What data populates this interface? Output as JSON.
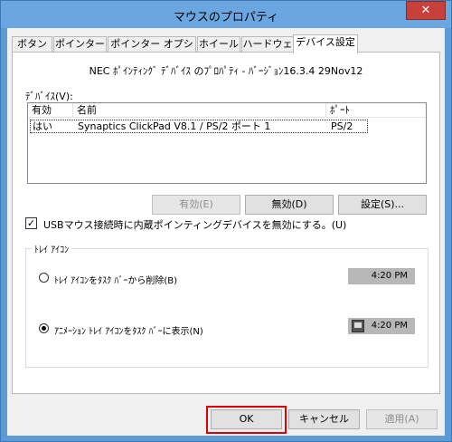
{
  "window": {
    "title": "マウスのプロパティ",
    "close_label": "✕"
  },
  "tabs": [
    {
      "label": "ボタン",
      "active": false
    },
    {
      "label": "ポインター",
      "active": false
    },
    {
      "label": "ポインター オプション",
      "active": false
    },
    {
      "label": "ホイール",
      "active": false
    },
    {
      "label": "ハードウェア",
      "active": false
    },
    {
      "label": "デバイス設定",
      "active": true
    }
  ],
  "device_settings": {
    "properties_line": "NEC ﾎﾟｲﾝﾃｨﾝｸﾞ ﾃﾞﾊﾞｲｽ のﾌﾟﾛﾊﾟﾃｨ - ﾊﾞｰｼﾞｮﾝ16.3.4 29Nov12",
    "devices_label": "ﾃﾞﾊﾞｲｽ(V):",
    "list": {
      "columns": [
        "有効",
        "名前",
        "ﾎﾟｰﾄ"
      ],
      "rows": [
        {
          "enabled": "はい",
          "name": "Synaptics ClickPad V8.1 / PS/2 ポート 1",
          "port": "PS/2"
        }
      ]
    },
    "buttons": {
      "enable": "有効(E)",
      "disable": "無効(D)",
      "settings": "設定(S)..."
    },
    "checkbox": {
      "label": "USBマウス接続時に内蔵ポインティングデバイスを無効にする。(U)",
      "checked": true,
      "mark": "✓"
    },
    "tray_group": {
      "title": "ﾄﾚｲ ｱｲｺﾝ",
      "option_remove": {
        "label": "ﾄﾚｲ ｱｲｺﾝをﾀｽｸ ﾊﾞｰから削除(B)",
        "checked": false,
        "time": "4:20 PM"
      },
      "option_show": {
        "label": "ｱﾆﾒｰｼｮﾝ ﾄﾚｲ ｱｲｺﾝをﾀｽｸ ﾊﾞｰに表示(N)",
        "checked": true,
        "time": "4:20 PM",
        "icon": "touchpad-tray-icon"
      }
    }
  },
  "dialog_buttons": {
    "ok": "OK",
    "cancel": "キャンセル",
    "apply": "適用(A)"
  },
  "colors": {
    "highlight": "#e00000",
    "window_frame": "#5b9bd5"
  }
}
